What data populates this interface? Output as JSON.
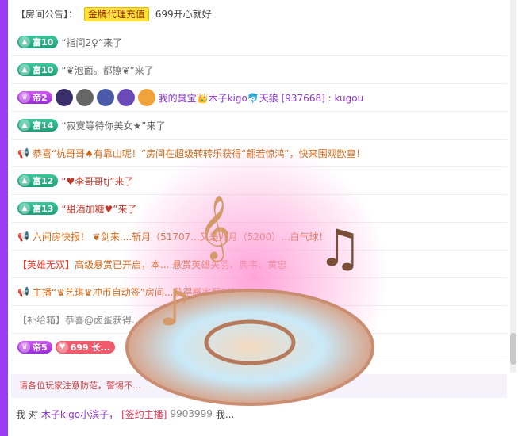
{
  "announcement": {
    "label": "【房间公告】：",
    "tag": "金牌代理充值",
    "text": "699开心就好"
  },
  "messages": [
    {
      "badge": "富10",
      "text": "“指间2♀”来了",
      "type": "fu"
    },
    {
      "badge": "富10",
      "text": "“❦泡面。都擦❦”来了",
      "type": "fu"
    },
    {
      "badge": "帝2",
      "text": "我的臭宝👑木子kigo🐬天狼 [937668] : kugou",
      "type": "di"
    },
    {
      "badge": "富14",
      "text": "“寂寞等待你美女★”来了",
      "type": "fu"
    },
    {
      "text": "恭喜“杭哥哥♠有靠山呢！”房间在超级转转乐获得“翩若惊鸿”，快来围观欧皇！",
      "type": "horn"
    },
    {
      "badge": "富12",
      "text": "“♥李哥哥tj”来了",
      "type": "fu"
    },
    {
      "badge": "富13",
      "text": "“甜酒加糖♥”来了",
      "type": "fu"
    },
    {
      "text": "六间房快报！ ❦剑来....斩月（51707...又是九月（5200）...白气球！",
      "type": "horn"
    },
    {
      "tag": "【英雄无双】",
      "text": "高级悬赏已开启，本... 悬赏英雄关羽、典韦、黄忠",
      "type": "hero"
    },
    {
      "text": "主播“♛艺琪♛冲币自动签”房间...获得概率翻5倍！",
      "type": "horn"
    },
    {
      "tag": "【补给箱】",
      "text": "恭喜@卤蛋获得...",
      "type": "box"
    },
    {
      "badge": "帝5",
      "extra": "699 长...",
      "type": "di"
    }
  ],
  "notice": "请各位玩家注意防范，警惕不...",
  "input": {
    "prefix": "我 对",
    "target": "木子kigo小滨子，",
    "tag": "[签约主播]",
    "id": "9903999",
    "suffix": "我..."
  }
}
